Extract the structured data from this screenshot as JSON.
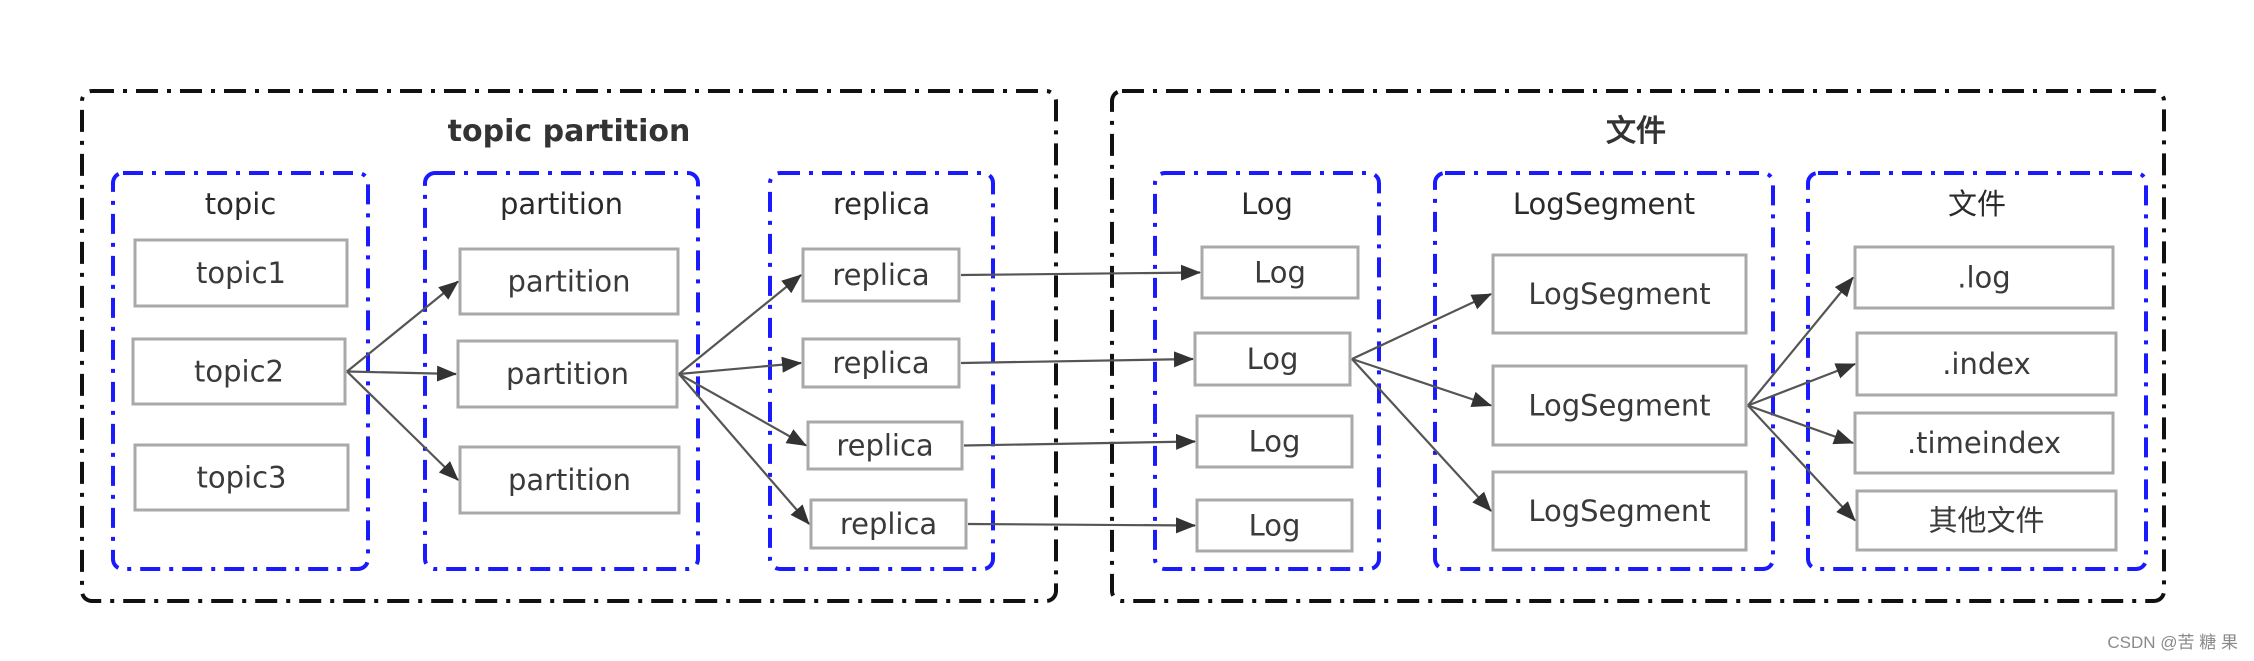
{
  "outer_groups": [
    {
      "id": "topic-partition",
      "title": "topic partition"
    },
    {
      "id": "files",
      "title": "文件"
    }
  ],
  "groups": [
    {
      "id": "topic",
      "title": "topic",
      "nodes": [
        "topic1",
        "topic2",
        "topic3"
      ]
    },
    {
      "id": "partition",
      "title": "partition",
      "nodes": [
        "partition",
        "partition",
        "partition"
      ]
    },
    {
      "id": "replica",
      "title": "replica",
      "nodes": [
        "replica",
        "replica",
        "replica",
        "replica"
      ]
    },
    {
      "id": "log",
      "title": "Log",
      "nodes": [
        "Log",
        "Log",
        "Log",
        "Log"
      ]
    },
    {
      "id": "logsegment",
      "title": "LogSegment",
      "nodes": [
        "LogSegment",
        "LogSegment",
        "LogSegment"
      ]
    },
    {
      "id": "file",
      "title": "文件",
      "nodes": [
        ".log",
        ".index",
        ".timeindex",
        "其他文件"
      ]
    }
  ],
  "edges": [
    {
      "from": "topic.1",
      "to": "partition.0"
    },
    {
      "from": "topic.1",
      "to": "partition.1"
    },
    {
      "from": "topic.1",
      "to": "partition.2"
    },
    {
      "from": "partition.1",
      "to": "replica.0"
    },
    {
      "from": "partition.1",
      "to": "replica.1"
    },
    {
      "from": "partition.1",
      "to": "replica.2"
    },
    {
      "from": "partition.1",
      "to": "replica.3"
    },
    {
      "from": "replica.0",
      "to": "log.0"
    },
    {
      "from": "replica.1",
      "to": "log.1"
    },
    {
      "from": "replica.2",
      "to": "log.2"
    },
    {
      "from": "replica.3",
      "to": "log.3"
    },
    {
      "from": "log.1",
      "to": "logsegment.0"
    },
    {
      "from": "log.1",
      "to": "logsegment.1"
    },
    {
      "from": "log.1",
      "to": "logsegment.2"
    },
    {
      "from": "logsegment.1",
      "to": "file.0"
    },
    {
      "from": "logsegment.1",
      "to": "file.1"
    },
    {
      "from": "logsegment.1",
      "to": "file.2"
    },
    {
      "from": "logsegment.1",
      "to": "file.3"
    }
  ],
  "colors": {
    "outer_border": "#111111",
    "group_border": "#1a1aff",
    "node_border": "#a9a9a9",
    "edge": "#555555",
    "arrowhead": "#333333"
  },
  "watermark": "CSDN @苦 糖 果"
}
